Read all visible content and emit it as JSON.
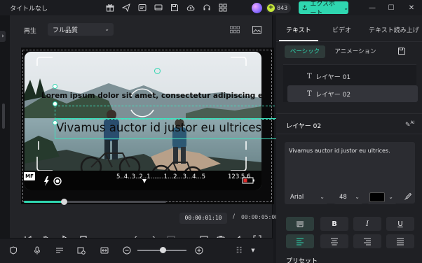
{
  "app": {
    "title": "タイトルなし",
    "credits": "843",
    "export_label": "エクスポート",
    "icons": [
      "gift-icon",
      "send-icon",
      "gauge-icon",
      "monitor-icon",
      "save-icon",
      "cloud-icon",
      "headset-icon",
      "grid-icon"
    ],
    "colors": {
      "accent": "#2fd6b0",
      "bg": "#18191d",
      "panel": "#232428"
    }
  },
  "preview": {
    "label": "再生",
    "quality": "フル品質",
    "caption_line1": "Lorem ipsum dolor sit amet, consectetur adipiscing el",
    "caption_line2": "Vivamus auctor id justor eu ultrices",
    "hud_mf": "MF",
    "hud_scale": "5..4..3..2..1.......1...2...3...4...5",
    "hud_value": "123.5.6",
    "progress": 0.28,
    "current_time": "00:00:01:10",
    "time_separator": "/",
    "total_time": "00:00:05:00"
  },
  "right_panel": {
    "tabs": [
      "テキスト",
      "ビデオ",
      "テキスト読み上げ"
    ],
    "active_tab": 0,
    "sub_tabs": [
      "ベーシック",
      "アニメーション"
    ],
    "active_sub_tab": 0,
    "layers": [
      "レイヤー 01",
      "レイヤー 02"
    ],
    "selected_layer": 1,
    "layer_heading": "レイヤー 02",
    "ai_label": "AI",
    "text_value": "Vivamus auctor id justor eu ultrices.",
    "font_family": "Arial",
    "font_size": "48",
    "text_color": "#000000",
    "format_buttons": [
      "B",
      "I",
      "U"
    ],
    "preset_label": "プリセット"
  }
}
